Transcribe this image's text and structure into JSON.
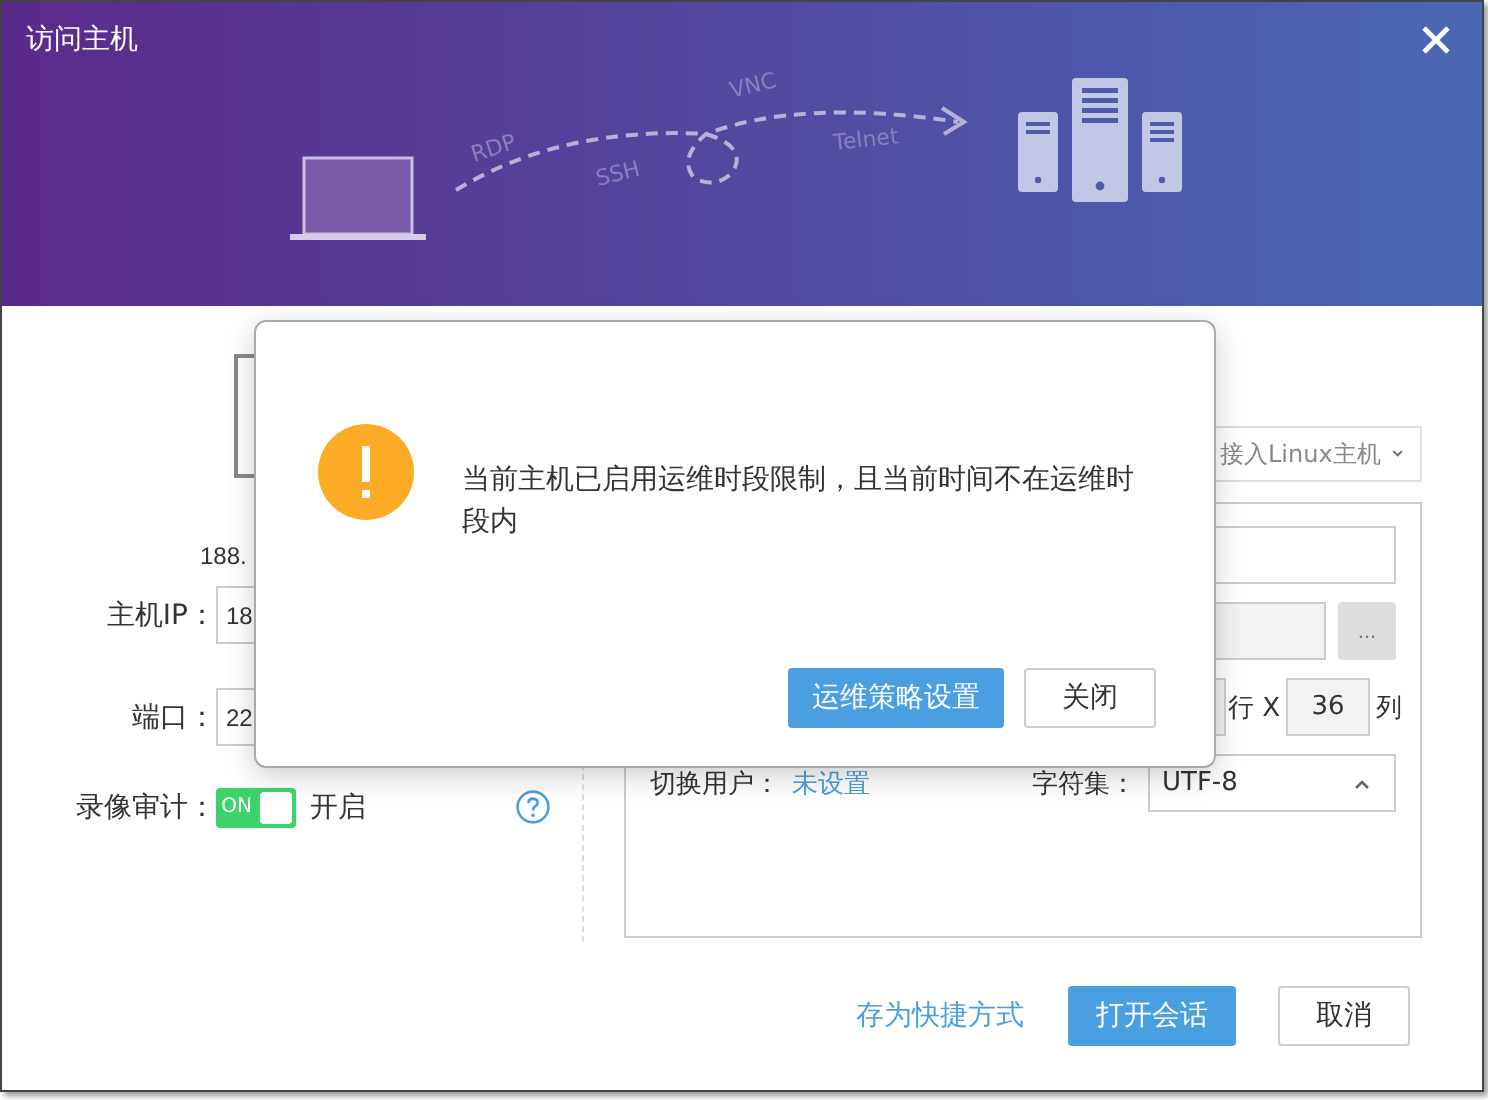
{
  "window": {
    "title": "访问主机"
  },
  "banner": {
    "protocols": [
      "RDP",
      "SSH",
      "VNC",
      "Telnet"
    ]
  },
  "host": {
    "address": "188."
  },
  "form": [
    {
      "label": "主机IP：",
      "value": "18"
    },
    {
      "label": "端口：",
      "value": "22"
    }
  ],
  "recording": {
    "label": "录像审计：",
    "on": true,
    "switch_text": "ON",
    "state_text": "开启"
  },
  "access": {
    "mode": "接入Linux主机"
  },
  "terminal": {
    "ellipsis": "...",
    "rows_label": "行 X",
    "cols": "36",
    "cols_label": "列"
  },
  "switch_user": {
    "label": "切换用户：",
    "value": "未设置"
  },
  "charset": {
    "label": "字符集：",
    "value": "UTF-8"
  },
  "footer": {
    "link": "存为快捷方式",
    "buttons": [
      {
        "label": "打开会话",
        "kind": "primary"
      },
      {
        "label": "取消",
        "kind": "default"
      }
    ]
  },
  "alert": {
    "message": "当前主机已启用运维时段限制，且当前时间不在运维时段内",
    "buttons": [
      {
        "label": "运维策略设置",
        "kind": "primary"
      },
      {
        "label": "关闭",
        "kind": "default"
      }
    ]
  }
}
